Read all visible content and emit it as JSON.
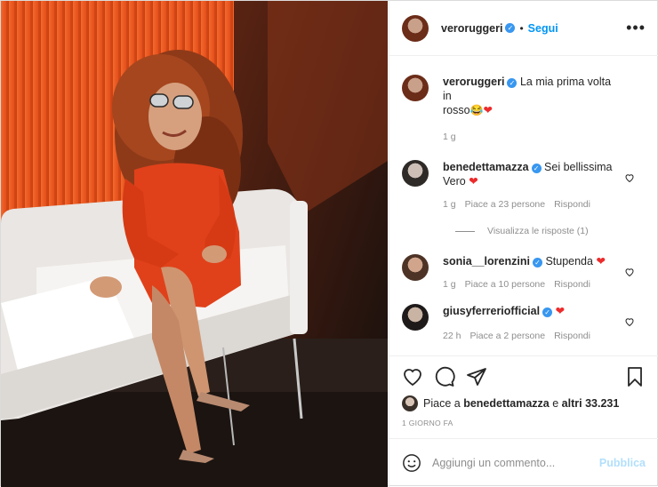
{
  "header": {
    "username": "veroruggeri",
    "separator": "•",
    "follow_label": "Segui",
    "more_icon": "more-horizontal-icon"
  },
  "caption": {
    "username": "veroruggeri",
    "text_line1": "La mia prima volta in",
    "text_line2": "rosso",
    "time": "1 g"
  },
  "comments": [
    {
      "username": "benedettamazza",
      "text_line1": "Sei bellissima",
      "text_line2": "Vero",
      "time": "1 g",
      "likes": "Piace a 23 persone",
      "reply": "Rispondi"
    },
    {
      "username": "sonia__lorenzini",
      "text": "Stupenda",
      "time": "1 g",
      "likes": "Piace a 10 persone",
      "reply": "Rispondi"
    },
    {
      "username": "giusyferreriofficial",
      "text": "",
      "time": "22 h",
      "likes": "Piace a 2 persone",
      "reply": "Rispondi"
    }
  ],
  "view_replies": "Visualizza le risposte (1)",
  "likes_line": {
    "prefix": "Piace a",
    "user": "benedettamazza",
    "middle": "e",
    "others": "altri 33.231"
  },
  "post_time": "1 GIORNO FA",
  "add_comment": {
    "placeholder": "Aggiungi un commento...",
    "publish_label": "Pubblica"
  },
  "colors": {
    "accent": "#0095f6",
    "publish_disabled": "#b2dffc",
    "heart": "#ed2b2b",
    "wall": "#e8501e"
  }
}
